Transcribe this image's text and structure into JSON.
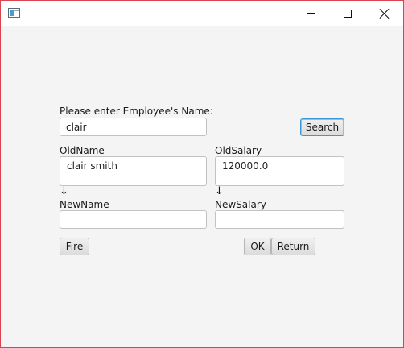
{
  "titlebar": {
    "title": ""
  },
  "form": {
    "prompt_label": "Please enter Employee's Name:",
    "search_value": "clair",
    "search_button": "Search",
    "old_name_label": "OldName",
    "old_name_value": "clair smith",
    "old_salary_label": "OldSalary",
    "old_salary_value": "120000.0",
    "arrow_glyph": "↓",
    "new_name_label": "NewName",
    "new_name_value": "",
    "new_salary_label": "NewSalary",
    "new_salary_value": ""
  },
  "actions": {
    "fire_label": "Fire",
    "ok_label": "OK",
    "return_label": "Return"
  },
  "colors": {
    "window_border": "#d9434f",
    "focus_accent": "#3b98d6",
    "background": "#f4f4f4"
  }
}
